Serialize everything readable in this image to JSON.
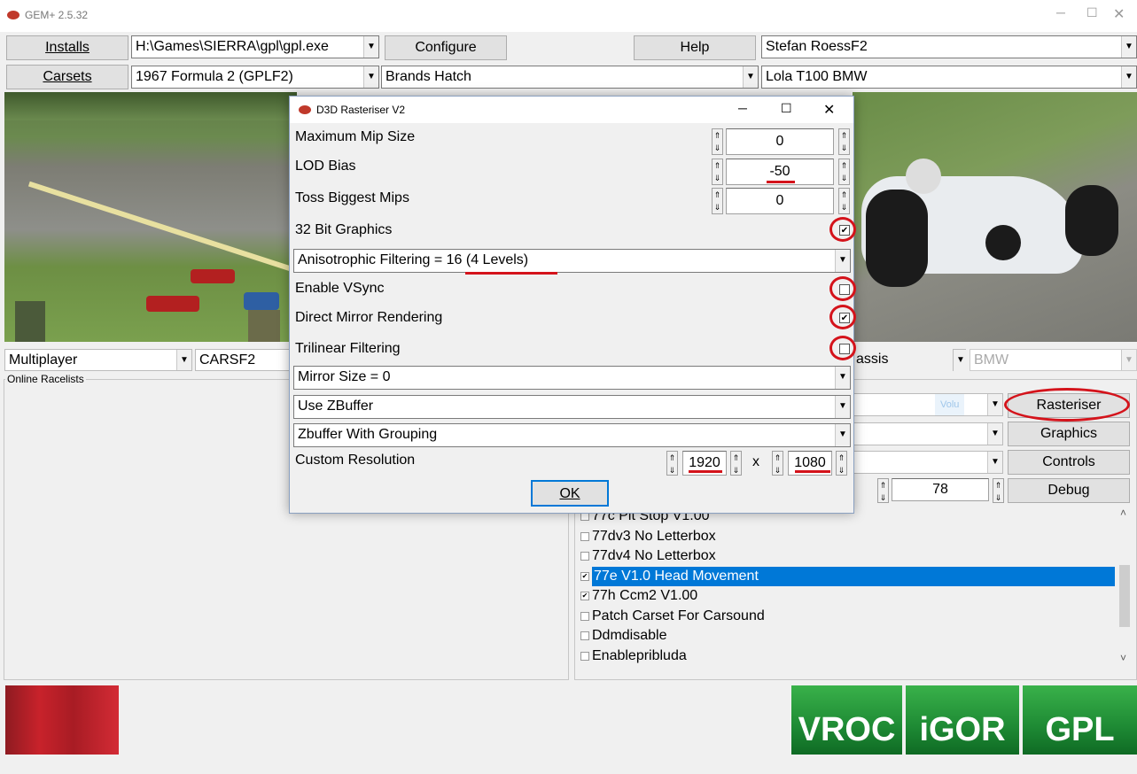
{
  "titlebar": {
    "title": "GEM+ 2.5.32"
  },
  "row1": {
    "installs_label": "Installs",
    "gpl_path": "H:\\Games\\SIERRA\\gpl\\gpl.exe",
    "configure_label": "Configure",
    "help_label": "Help",
    "player": "Stefan RoessF2"
  },
  "row2": {
    "carsets_label": "Carsets",
    "carset": "1967 Formula 2 (GPLF2)",
    "track": "Brands Hatch",
    "car": "Lola T100 BMW"
  },
  "row3": {
    "mode": "Multiplayer",
    "cars_folder": "CARSF2",
    "chassis_partial": "assis",
    "engine": "BMW"
  },
  "online": {
    "legend": "Online Racelists"
  },
  "right_panel": {
    "rasteriser_label": "Rasteriser",
    "graphics_label": "Graphics",
    "controls_label": "Controls",
    "debug_label": "Debug",
    "spin_value": "78",
    "faded_text": "Volu"
  },
  "patches": {
    "items": [
      {
        "label": "77c Pit Stop V1.00",
        "checked": false,
        "selected": false
      },
      {
        "label": "77dv3 No Letterbox",
        "checked": false,
        "selected": false
      },
      {
        "label": "77dv4 No Letterbox",
        "checked": false,
        "selected": false
      },
      {
        "label": "77e V1.0 Head Movement",
        "checked": true,
        "selected": true
      },
      {
        "label": "77h Ccm2 V1.00",
        "checked": true,
        "selected": false
      },
      {
        "label": "Patch Carset For Carsound",
        "checked": false,
        "selected": false
      },
      {
        "label": "Ddmdisable",
        "checked": false,
        "selected": false
      },
      {
        "label": "Enablepribluda",
        "checked": false,
        "selected": false
      }
    ]
  },
  "tiles": {
    "vroc": "VROC",
    "igor": "iGOR",
    "gpl": "GPL"
  },
  "dialog": {
    "title": "D3D Rasteriser V2",
    "max_mip_label": "Maximum Mip Size",
    "max_mip_value": "0",
    "lod_bias_label": "LOD Bias",
    "lod_bias_value": "-50",
    "toss_mips_label": "Toss Biggest Mips",
    "toss_mips_value": "0",
    "bit32_label": "32 Bit Graphics",
    "bit32_checked": true,
    "aniso_prefix": "Anisotrophic Filtering = ",
    "aniso_value": "16 (4 Levels)",
    "vsync_label": "Enable VSync",
    "vsync_checked": false,
    "mirror_render_label": "Direct Mirror Rendering",
    "mirror_render_checked": true,
    "trilinear_label": "Trilinear Filtering",
    "trilinear_checked": false,
    "mirror_size": "Mirror Size = 0",
    "zbuffer": "Use ZBuffer",
    "zbuffer_group": "Zbuffer With Grouping",
    "custom_res_label": "Custom Resolution",
    "res_width": "1920",
    "res_x": "x",
    "res_height": "1080",
    "ok_label": "OK"
  },
  "colors": {
    "annotation_red": "#d4131b",
    "selection_blue": "#0078d7",
    "tile_green": "#1e8a34"
  }
}
